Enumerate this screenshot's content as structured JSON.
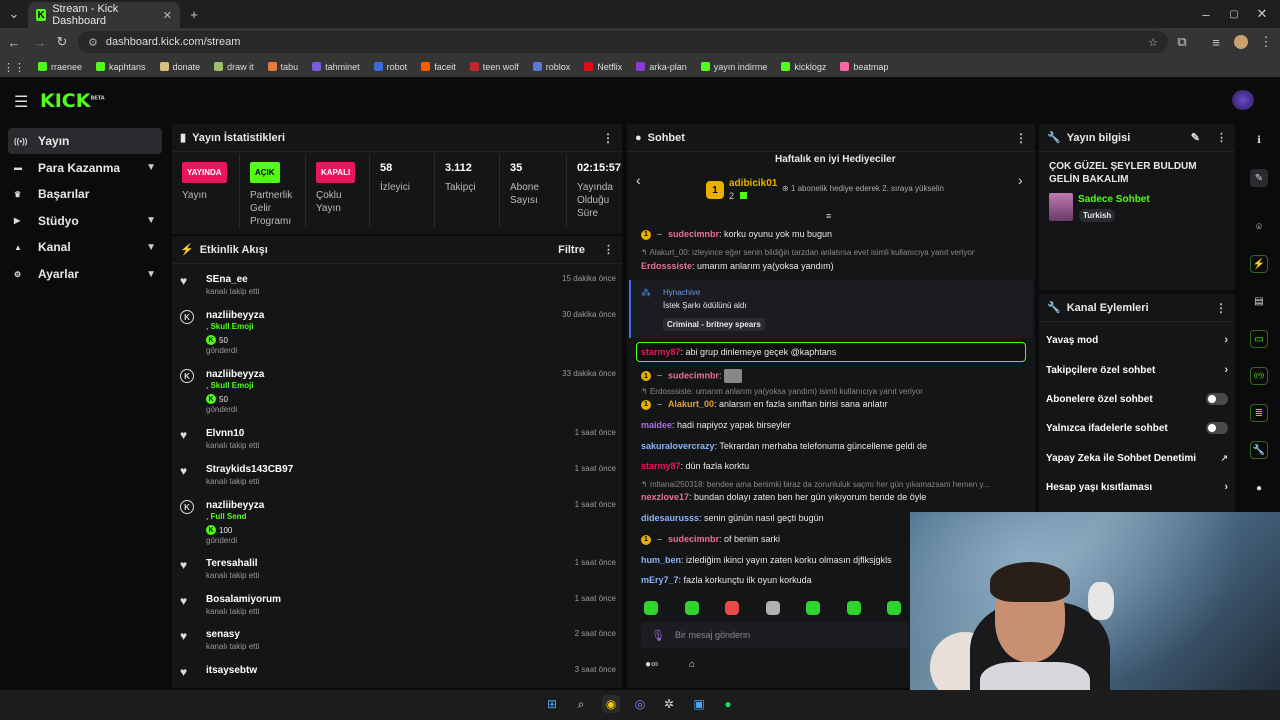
{
  "browser": {
    "tab_title": "Stream - Kick Dashboard",
    "url": "dashboard.kick.com/stream",
    "bookmarks": [
      {
        "label": "rraenee",
        "color": "#53fc18"
      },
      {
        "label": "kaphtans",
        "color": "#53fc18"
      },
      {
        "label": "donate",
        "color": "#d8c27a"
      },
      {
        "label": "draw it",
        "color": "#9bbf6a"
      },
      {
        "label": "tabu",
        "color": "#e87a3a"
      },
      {
        "label": "tahminet",
        "color": "#7a5ad8"
      },
      {
        "label": "robot",
        "color": "#3a6ad8"
      },
      {
        "label": "faceit",
        "color": "#ff5a00"
      },
      {
        "label": "teen wolf",
        "color": "#c02a2a"
      },
      {
        "label": "roblox",
        "color": "#5a7ad8"
      },
      {
        "label": "Netflix",
        "color": "#e50914"
      },
      {
        "label": "arka-plan",
        "color": "#8a3ad8"
      },
      {
        "label": "yayın indirme",
        "color": "#53fc18"
      },
      {
        "label": "kicklogz",
        "color": "#53fc18"
      },
      {
        "label": "beatmap",
        "color": "#ff66aa"
      }
    ]
  },
  "sidebar": {
    "items": [
      {
        "label": "Yayın",
        "icon": "broadcast-icon",
        "expandable": false
      },
      {
        "label": "Para Kazanma",
        "icon": "money-icon",
        "expandable": true
      },
      {
        "label": "Başarılar",
        "icon": "trophy-icon",
        "expandable": false
      },
      {
        "label": "Stüdyo",
        "icon": "video-icon",
        "expandable": true
      },
      {
        "label": "Kanal",
        "icon": "user-icon",
        "expandable": true
      },
      {
        "label": "Ayarlar",
        "icon": "gear-icon",
        "expandable": true
      }
    ]
  },
  "stats": {
    "title": "Yayın İstatistikleri",
    "cells": [
      {
        "badge": "YAYINDA",
        "label": "Yayın",
        "badge_color": "#e8175d"
      },
      {
        "badge": "AÇIK",
        "label": "Partnerlik Gelir Programı",
        "badge_color": "#53fc18"
      },
      {
        "badge": "KAPALI",
        "label": "Çoklu Yayın",
        "badge_color": "#e8175d"
      },
      {
        "value": "58",
        "label": "İzleyici"
      },
      {
        "value": "3.112",
        "label": "Takipçi"
      },
      {
        "value": "35",
        "label": "Abone Sayısı"
      },
      {
        "value": "02:15:57",
        "label": "Yayında Olduğu Süre"
      }
    ]
  },
  "activity": {
    "title": "Etkinlik Akışı",
    "filter_label": "Filtre",
    "events": [
      {
        "icon": "heart",
        "name": "SEna_ee",
        "sub": "kanalı takip etti",
        "time": "15 dakika önce"
      },
      {
        "icon": "kick",
        "name": "nazliibeyyza",
        "gift": "Skull Emoji",
        "amount": "50",
        "sub": "gönderdi",
        "time": "30 dakika önce"
      },
      {
        "icon": "kick",
        "name": "nazliibeyyza",
        "gift": "Skull Emoji",
        "amount": "50",
        "sub": "gönderdi",
        "time": "33 dakika önce"
      },
      {
        "icon": "heart",
        "name": "Elvnn10",
        "sub": "kanalı takip etti",
        "time": "1 saat önce"
      },
      {
        "icon": "heart",
        "name": "Straykids143CB97",
        "sub": "kanalı takip etti",
        "time": "1 saat önce"
      },
      {
        "icon": "kick",
        "name": "nazliibeyyza",
        "gift": "Full Send",
        "amount": "100",
        "sub": "gönderdi",
        "time": "1 saat önce"
      },
      {
        "icon": "heart",
        "name": "Teresahalil",
        "sub": "kanalı takip etti",
        "time": "1 saat önce"
      },
      {
        "icon": "heart",
        "name": "Bosalamiyorum",
        "sub": "kanalı takip etti",
        "time": "1 saat önce"
      },
      {
        "icon": "heart",
        "name": "senasy",
        "sub": "kanalı takip etti",
        "time": "2 saat önce"
      },
      {
        "icon": "heart",
        "name": "itsaysebtw",
        "sub": "",
        "time": "3 saat önce"
      }
    ]
  },
  "chat": {
    "title": "Sohbet",
    "top_gifters_title": "Haftalık en iyi Hediyeciler",
    "top_gifter_name": "adibicik01",
    "top_gifter_rank": "1",
    "top_gifter_count": "2",
    "top_gifter_note": "1 abonelik hediye ederek 2. sıraya yükselin",
    "reward": {
      "user": "Hynachive",
      "text": "İstek Şarkı ödülünü aldı",
      "song": "Criminal - britney spears"
    },
    "messages": [
      {
        "type": "msg",
        "badge": "1",
        "user": "sudecimnbr",
        "color": "#e8709a",
        "text": "korku oyunu yok mu bugun"
      },
      {
        "type": "reply",
        "text": "Alakurt_00: izleyince eğer senin bildiğin tarzdan anlatırsa evet isimli kullanıcıya yanıt veriyor"
      },
      {
        "type": "msg",
        "user": "Erdosssiste",
        "color": "#e8709a",
        "text": "umarım anlarım ya(yoksa yandım)"
      },
      {
        "type": "msg",
        "user": "starmy87",
        "color": "#e8175d",
        "text": "abi grup dinlemeye geçek @kaphtans"
      },
      {
        "type": "msg",
        "badge": "1",
        "user": "sudecimnbr",
        "color": "#e8709a",
        "text": ""
      },
      {
        "type": "reply",
        "text": "Erdosssiste: umarım anlarım ya(yoksa yandım) isimli kullanıcıya yanıt veriyor"
      },
      {
        "type": "msg",
        "badge": "1",
        "user": "Alakurt_00",
        "color": "#e8a030",
        "text": "anlarsın en fazla sınıftan birisi sana anlatır"
      },
      {
        "type": "msg",
        "user": "maidee",
        "color": "#b06ae8",
        "text": "hadi napiyoz yapak birseyler"
      },
      {
        "type": "msg",
        "user": "sakuralovercrazy",
        "color": "#8ab4f8",
        "text": "Tekrardan merhaba telefonuma güncelleme geldi de"
      },
      {
        "type": "msg",
        "user": "starmy87",
        "color": "#e8175d",
        "text": "dün fazla korktu"
      },
      {
        "type": "reply",
        "text": "mltanai250318: bendee ama benimki biraz da zorunluluk saçmı her gün yıkamazsam hemen y..."
      },
      {
        "type": "msg",
        "user": "nexzlove17",
        "color": "#e8709a",
        "text": "bundan dolayı zaten ben her gün yıkıyorum bende de öyle"
      },
      {
        "type": "msg",
        "user": "didesaurusss",
        "color": "#8ab4f8",
        "text": "senin günün nasıl geçti bugün"
      },
      {
        "type": "msg",
        "badge": "1",
        "user": "sudecimnbr",
        "color": "#e8709a",
        "text": "of benim sarki"
      },
      {
        "type": "msg",
        "user": "hum_ben",
        "color": "#8ab4f8",
        "text": "izlediğim ikinci yayın zaten korku olmasın djflksjgkls"
      },
      {
        "type": "msg",
        "user": "mEry7_7",
        "color": "#8ab4f8",
        "text": "fazla korkunçtu ilk oyun korkuda"
      }
    ],
    "input_placeholder": "Bir mesaj gönderin"
  },
  "stream_info": {
    "title": "Yayın bilgisi",
    "stream_title": "ÇOK GÜZEL ŞEYLER BULDUM GELİN BAKALIM",
    "category": "Sadece Sohbet",
    "language": "Turkish"
  },
  "channel_actions": {
    "title": "Kanal Eylemleri",
    "items": [
      {
        "label": "Yavaş mod",
        "control": "arrow"
      },
      {
        "label": "Takipçilere özel sohbet",
        "control": "arrow"
      },
      {
        "label": "Abonelere özel sohbet",
        "control": "toggle"
      },
      {
        "label": "Yalnızca ifadelerle sohbet",
        "control": "toggle"
      },
      {
        "label": "Yapay Zeka ile Sohbet Denetimi",
        "control": "external"
      },
      {
        "label": "Hesap yaşı kısıtlaması",
        "control": "arrow"
      }
    ]
  },
  "colors": {
    "accent": "#53fc18",
    "live": "#e8175d",
    "panel": "#141517"
  }
}
